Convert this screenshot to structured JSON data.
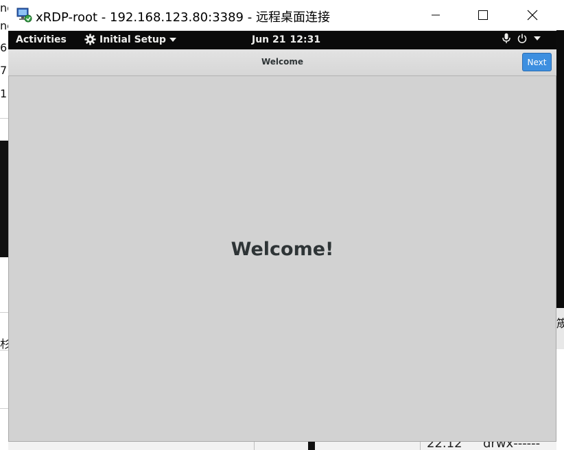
{
  "rdp_window": {
    "title": "xRDP-root - 192.168.123.80:3389 - 远程桌面连接",
    "icon": "remote-desktop-icon",
    "controls": {
      "minimize": "minimize-icon",
      "maximize": "maximize-icon",
      "close": "close-icon"
    }
  },
  "gnome_topbar": {
    "activities": "Activities",
    "app_menu": {
      "icon": "gear-icon",
      "label": "Initial Setup",
      "dropdown_icon": "triangle-down-icon"
    },
    "clock": {
      "date": "Jun 21",
      "time": "12:31"
    },
    "system_icons": [
      "microphone-icon",
      "power-icon",
      "triangle-down-icon"
    ]
  },
  "initial_setup": {
    "header_title": "Welcome",
    "next_button": "Next",
    "heading": "Welcome!"
  },
  "background_fragments": {
    "left": [
      "nc",
      "nc",
      "6",
      "7",
      "1"
    ],
    "left_lower": "杉",
    "right": "筬",
    "bottom": [
      "22.12",
      "drwx------"
    ]
  },
  "colors": {
    "gnome_bar": "#0a0a0a",
    "setup_background": "#d2d2d2",
    "next_button": "#3d8fe0"
  }
}
